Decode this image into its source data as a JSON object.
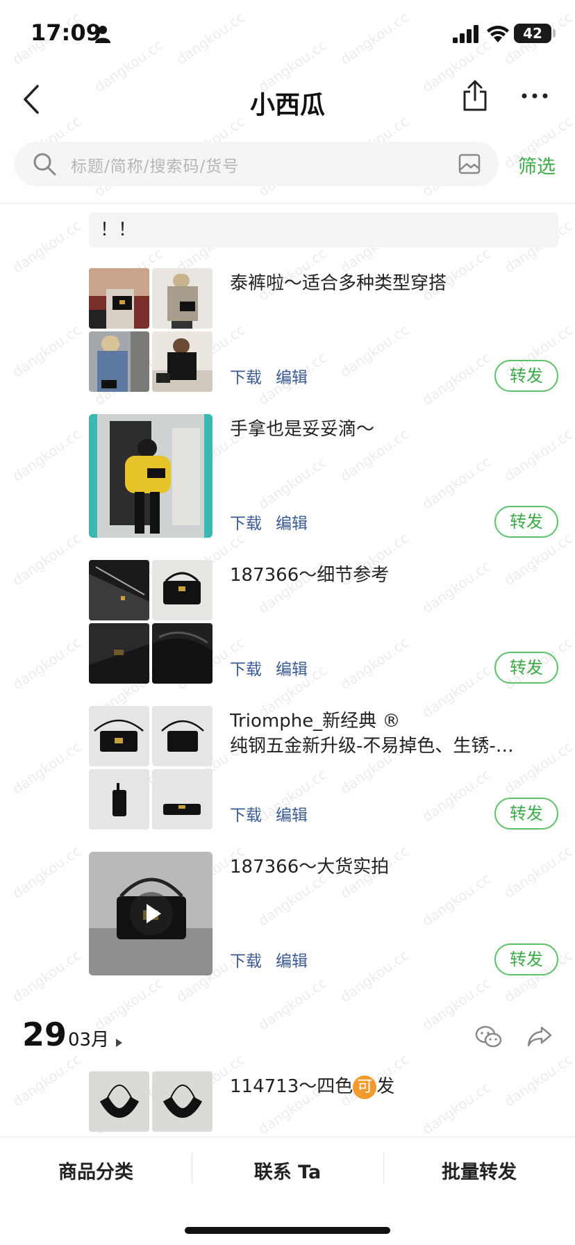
{
  "status_bar": {
    "time": "17:09",
    "battery": "42"
  },
  "nav": {
    "title": "小西瓜"
  },
  "search": {
    "placeholder": "标题/简称/搜索码/货号",
    "filter_label": "筛选"
  },
  "notice": "！！",
  "posts": [
    {
      "text_lines": [
        "泰裤啦～适合多种类型穿搭"
      ],
      "download_label": "下载",
      "edit_label": "编辑",
      "forward_label": "转发"
    },
    {
      "text_lines": [
        "手拿也是妥妥滴～"
      ],
      "download_label": "下载",
      "edit_label": "编辑",
      "forward_label": "转发"
    },
    {
      "text_lines": [
        "187366～细节参考"
      ],
      "download_label": "下载",
      "edit_label": "编辑",
      "forward_label": "转发"
    },
    {
      "text_lines": [
        "Triomphe_新经典 ®",
        "纯钢五金新升级-不易掉色、生锈-…"
      ],
      "download_label": "下载",
      "edit_label": "编辑",
      "forward_label": "转发"
    },
    {
      "text_lines": [
        "187366～大货实拍"
      ],
      "download_label": "下载",
      "edit_label": "编辑",
      "forward_label": "转发"
    }
  ],
  "date_group": {
    "day": "29",
    "month": "03月"
  },
  "last_post": {
    "text_before": "114713～四色",
    "badge": "可",
    "text_after": "发"
  },
  "tabs": [
    "商品分类",
    "联系 Ta",
    "批量转发"
  ],
  "watermark": "dangkou.cc",
  "colors": {
    "accent_green": "#3daa49",
    "link_blue": "#3b5b94",
    "badge_orange": "#f29a2e"
  }
}
